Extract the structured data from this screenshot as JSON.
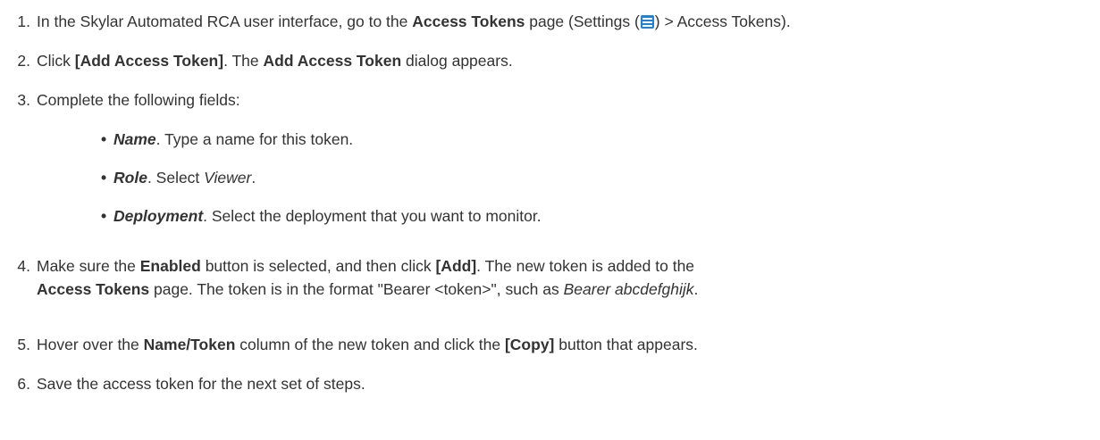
{
  "steps": [
    {
      "num": "1.",
      "a": "In the Skylar Automated RCA user interface, go to the ",
      "b": "Access Tokens",
      "c": " page (Settings (",
      "d": ") > Access Tokens)."
    },
    {
      "num": "2.",
      "a": "Click ",
      "b": "[Add Access Token]",
      "c": ". The ",
      "d": "Add Access Token",
      "e": " dialog appears."
    },
    {
      "num": "3.",
      "a": "Complete the following fields:"
    },
    {
      "num": "4.",
      "a": "Make sure the ",
      "b": "Enabled",
      "c": " button is selected, and then click ",
      "d": "[Add]",
      "e": ". The new token is added to the",
      "f": "Access Tokens",
      "g": " page. The token is in the format \"Bearer <token>\", such as ",
      "h": "Bearer abcdefghijk",
      "i": "."
    },
    {
      "num": "5.",
      "a": "Hover over the ",
      "b": "Name/Token",
      "c": " column of the new token and click the ",
      "d": "[Copy]",
      "e": " button that appears."
    },
    {
      "num": "6.",
      "a": "Save the access token for the next set of steps."
    }
  ],
  "fields": [
    {
      "label": "Name",
      "text": ". Type a name for this token."
    },
    {
      "label": "Role",
      "text": ". Select ",
      "value": "Viewer",
      "end": "."
    },
    {
      "label": "Deployment",
      "text": ". Select the deployment that you want to monitor."
    }
  ],
  "icons": {
    "settings": "settings-menu-icon",
    "settings_color": "#1e82d6"
  }
}
